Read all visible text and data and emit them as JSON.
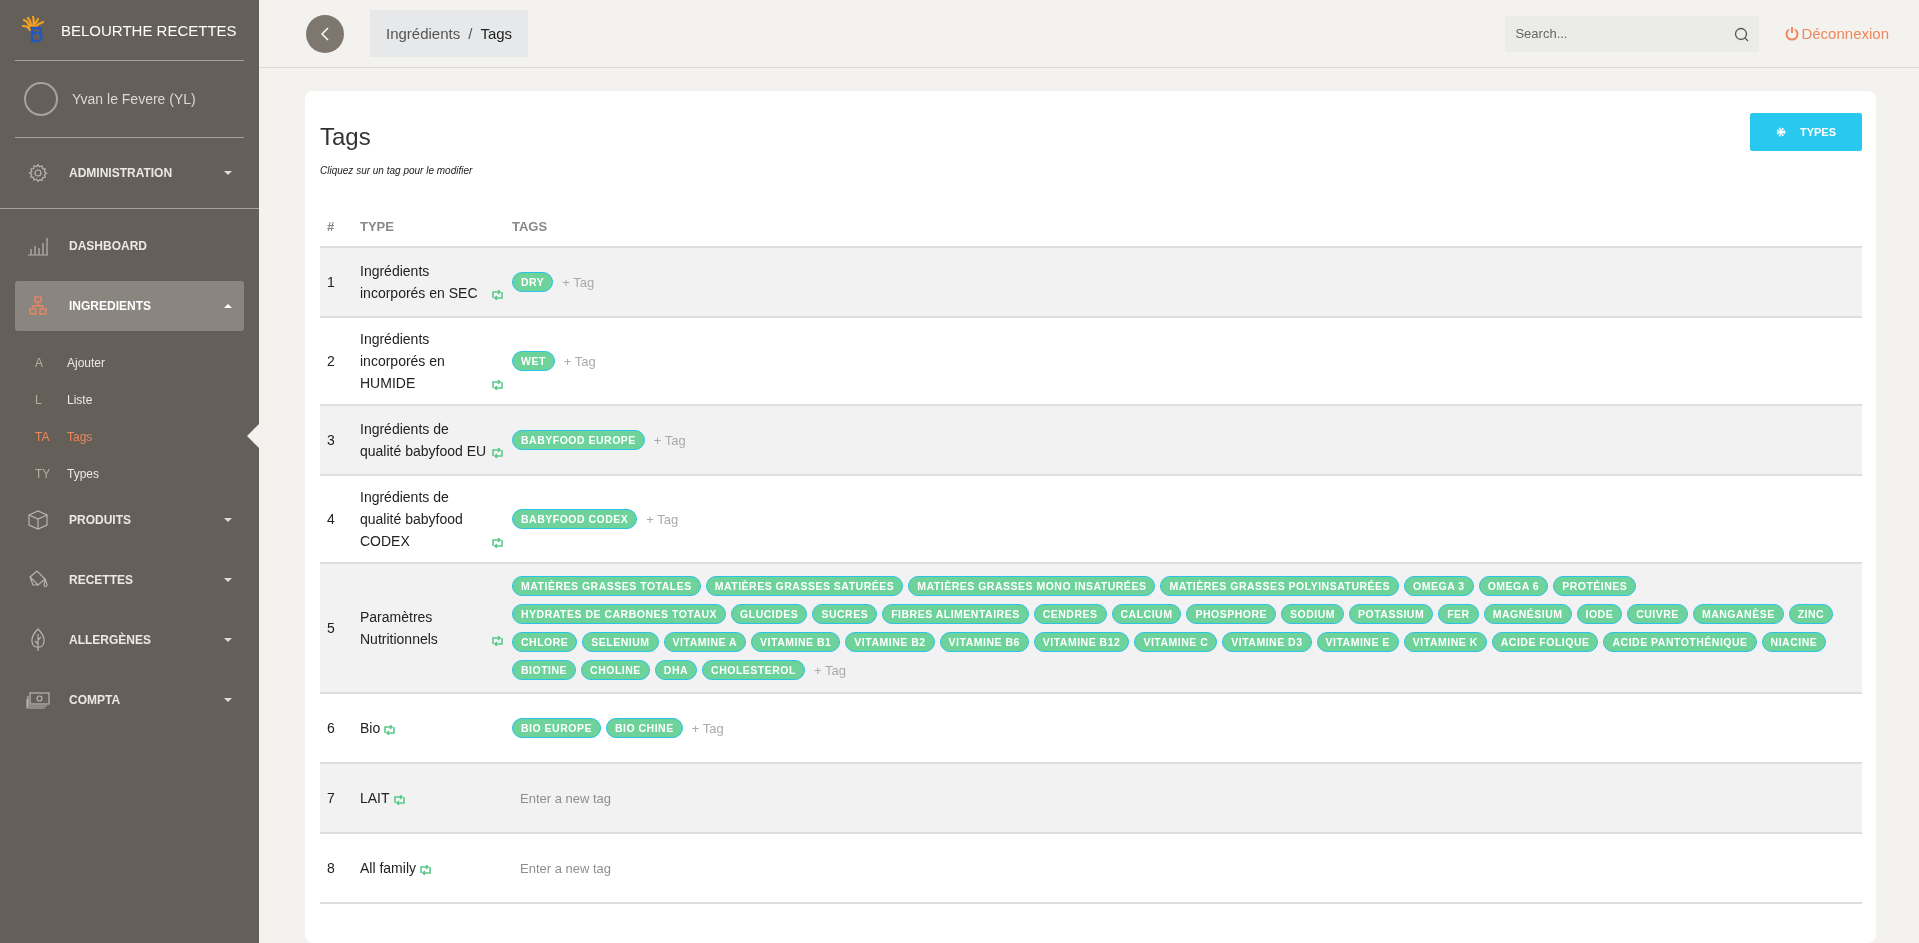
{
  "sidebar": {
    "brand": "BELOURTHE RECETTES",
    "user": "Yvan le Fevere (YL)",
    "items": [
      {
        "label": "ADMINISTRATION",
        "expanded": false,
        "has_caret": true
      },
      {
        "label": "DASHBOARD",
        "expanded": false,
        "has_caret": false
      },
      {
        "label": "INGREDIENTS",
        "expanded": true,
        "has_caret": true,
        "children": [
          {
            "abbr": "A",
            "label": "Ajouter",
            "selected": false
          },
          {
            "abbr": "L",
            "label": "Liste",
            "selected": false
          },
          {
            "abbr": "TA",
            "label": "Tags",
            "selected": true
          },
          {
            "abbr": "TY",
            "label": "Types",
            "selected": false
          }
        ]
      },
      {
        "label": "PRODUITS",
        "expanded": false,
        "has_caret": true
      },
      {
        "label": "RECETTES",
        "expanded": false,
        "has_caret": true
      },
      {
        "label": "ALLERGÈNES",
        "expanded": false,
        "has_caret": true
      },
      {
        "label": "COMPTA",
        "expanded": false,
        "has_caret": true
      }
    ]
  },
  "header": {
    "breadcrumb": [
      "Ingrédients",
      "Tags"
    ],
    "breadcrumb_separator": "/",
    "search": {
      "placeholder": "Search..."
    },
    "logout": "Déconnexion"
  },
  "card": {
    "title": "Tags",
    "hint": "Cliquez sur un tag pour le modifier",
    "button": "TYPES",
    "table": {
      "columns": [
        "#",
        "TYPE",
        "TAGS"
      ],
      "rows": [
        {
          "num": "1",
          "type": "Ingrédients incorporés en SEC",
          "tags": [
            "DRY"
          ],
          "add": "+ Tag"
        },
        {
          "num": "2",
          "type": "Ingrédients incorporés en HUMIDE",
          "tags": [
            "WET"
          ],
          "add": "+ Tag"
        },
        {
          "num": "3",
          "type": "Ingrédients de qualité babyfood EU",
          "tags": [
            "BABYFOOD EUROPE"
          ],
          "add": "+ Tag"
        },
        {
          "num": "4",
          "type": "Ingrédients de qualité babyfood CODEX",
          "tags": [
            "BABYFOOD CODEX"
          ],
          "add": "+ Tag"
        },
        {
          "num": "5",
          "type": "Paramètres Nutritionnels",
          "tags": [
            "MATIÈRES GRASSES TOTALES",
            "MATIÈRES GRASSES SATURÉES",
            "MATIÈRES GRASSES MONO INSATURÉES",
            "MATIÈRES GRASSES POLYINSATURÉES",
            "OMEGA 3",
            "OMEGA 6",
            "PROTÉINES",
            "HYDRATES DE CARBONES TOTAUX",
            "GLUCIDES",
            "SUCRES",
            "FIBRES ALIMENTAIRES",
            "CENDRES",
            "CALCIUM",
            "PHOSPHORE",
            "SODIUM",
            "POTASSIUM",
            "FER",
            "MAGNÉSIUM",
            "IODE",
            "CUIVRE",
            "MANGANÈSE",
            "ZINC",
            "CHLORE",
            "SELENIUM",
            "VITAMINE A",
            "VITAMINE B1",
            "VITAMINE B2",
            "VITAMINE B6",
            "VITAMINE B12",
            "VITAMINE C",
            "VITAMINE D3",
            "VITAMINE E",
            "VITAMINE K",
            "ACIDE FOLIQUE",
            "ACIDE PANTOTHÉNIQUE",
            "NIACINE",
            "BIOTINE",
            "CHOLINE",
            "DHA",
            "CHOLESTEROL"
          ],
          "add": "+ Tag"
        },
        {
          "num": "6",
          "type": "Bio",
          "tags": [
            "BIO EUROPE",
            "BIO CHINE"
          ],
          "add": "+ Tag"
        },
        {
          "num": "7",
          "type": "LAIT",
          "tags": [],
          "placeholder": "Enter a new tag"
        },
        {
          "num": "8",
          "type": "All family",
          "tags": [],
          "placeholder": "Enter a new tag"
        }
      ]
    }
  }
}
